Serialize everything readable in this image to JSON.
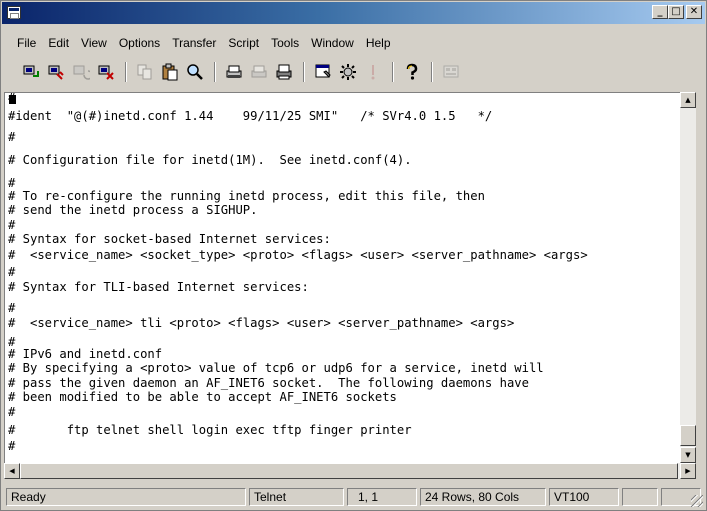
{
  "window": {
    "title": ""
  },
  "menu": [
    "File",
    "Edit",
    "View",
    "Options",
    "Transfer",
    "Script",
    "Tools",
    "Window",
    "Help"
  ],
  "toolbar": {
    "buttons": [
      {
        "icon": "connect-icon",
        "enabled": true
      },
      {
        "icon": "quick-connect-icon",
        "enabled": true
      },
      {
        "icon": "reconnect-icon",
        "enabled": false
      },
      {
        "icon": "disconnect-icon",
        "enabled": true
      },
      {
        "icon": "copy-icon",
        "enabled": false
      },
      {
        "icon": "paste-icon",
        "enabled": true
      },
      {
        "icon": "find-icon",
        "enabled": true
      },
      {
        "icon": "print-setup-icon",
        "enabled": true
      },
      {
        "icon": "print-selection-icon",
        "enabled": false
      },
      {
        "icon": "print-icon",
        "enabled": true
      },
      {
        "icon": "session-options-icon",
        "enabled": true
      },
      {
        "icon": "global-options-icon",
        "enabled": true
      },
      {
        "icon": "sftp-icon",
        "enabled": false
      },
      {
        "icon": "help-icon",
        "enabled": true
      },
      {
        "icon": "keymap-icon",
        "enabled": false
      }
    ]
  },
  "terminal": {
    "lines": [
      "#",
      "#ident  \"@(#)inetd.conf 1.44    99/11/25 SMI\"   /* SVr4.0 1.5   */",
      "#",
      "# Configuration file for inetd(1M).  See inetd.conf(4).",
      "#",
      "# To re-configure the running inetd process, edit this file, then",
      "# send the inetd process a SIGHUP.",
      "#",
      "# Syntax for socket-based Internet services:",
      "#  <service_name> <socket_type> <proto> <flags> <user> <server_pathname> <args>",
      "#",
      "# Syntax for TLI-based Internet services:",
      "#",
      "#  <service_name> tli <proto> <flags> <user> <server_pathname> <args>",
      "#",
      "# IPv6 and inetd.conf",
      "# By specifying a <proto> value of tcp6 or udp6 for a service, inetd will",
      "# pass the given daemon an AF_INET6 socket.  The following daemons have",
      "# been modified to be able to accept AF_INET6 sockets",
      "#",
      "#       ftp telnet shell login exec tftp finger printer",
      "#"
    ]
  },
  "status": {
    "state": "Ready",
    "protocol": "Telnet",
    "cursor_pos": "1,  1",
    "dimensions": "24 Rows, 80 Cols",
    "emulation": "VT100"
  },
  "colors": {
    "title_start": "#0a246a",
    "title_end": "#a6caf0",
    "chrome": "#d4d0c8",
    "terminal_bg": "#ffffff"
  }
}
